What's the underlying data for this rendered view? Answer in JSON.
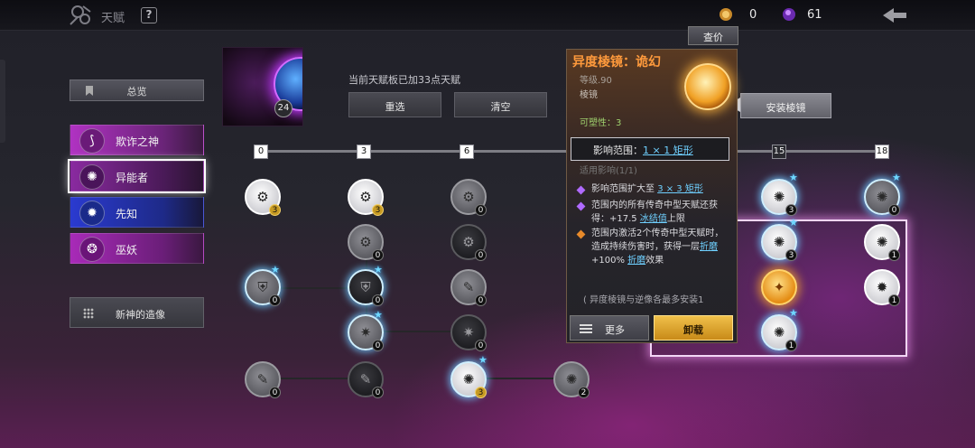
{
  "header": {
    "title": "天赋",
    "help": "?",
    "currency_1": "0",
    "currency_2": "61"
  },
  "sidebar": {
    "overview": "总览",
    "gods": [
      {
        "label": "欺诈之神",
        "color": "#9a2aa8"
      },
      {
        "label": "异能者",
        "color": "#5a1f66"
      },
      {
        "label": "先知",
        "color": "#2a3aa8"
      },
      {
        "label": "巫妖",
        "color": "#8a2a98"
      }
    ],
    "statue": "新神的造像"
  },
  "board": {
    "level": "24",
    "info": "当前天赋板已加33点天赋",
    "reselect": "重选",
    "clear": "清空",
    "install": "安装棱镜",
    "markers": [
      "0",
      "3",
      "6",
      "15",
      "18"
    ]
  },
  "nodes": {
    "badges": [
      "3",
      "3",
      "0",
      "0",
      "0",
      "0",
      "0",
      "0",
      "0",
      "0",
      "0",
      "0",
      "3",
      "3",
      "1",
      "1",
      "0",
      "0",
      "2",
      "3",
      "1",
      "0",
      "0",
      "2",
      "3",
      "0"
    ]
  },
  "popup": {
    "price": "查价",
    "title": "异度棱镜：诡幻",
    "level": "等级.90",
    "type": "棱镜",
    "plasticity": "可塑性：3",
    "range_label": "影响范围：",
    "range_value": "1 × 1 矩形",
    "cut_text": "适用影响(1/1)",
    "effect1_a": "影响范围扩大至",
    "effect1_b": "3 × 3 矩形",
    "effect2_a": "范围内的所有传奇中型天赋还获得：+17.5",
    "effect2_b": "冰结值",
    "effect2_c": "上限",
    "effect3_a": "范围内激活2个传奇中型天赋时，造成持续伤害时，获得一层",
    "effect3_b": "折磨",
    "effect3_c": "+100%",
    "effect3_d": "折磨",
    "effect3_e": "效果",
    "footer": "( 异度棱镜与逆像各最多安装1",
    "more": "更多",
    "unload": "卸载"
  }
}
